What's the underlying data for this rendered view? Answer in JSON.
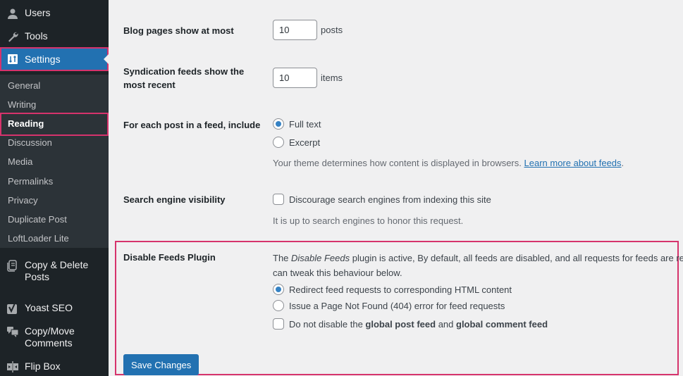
{
  "sidebar": {
    "top_items": [
      {
        "label": "Users",
        "icon": "users-icon"
      },
      {
        "label": "Tools",
        "icon": "wrench-icon"
      },
      {
        "label": "Settings",
        "icon": "settings-icon"
      }
    ],
    "submenu": [
      "General",
      "Writing",
      "Reading",
      "Discussion",
      "Media",
      "Permalinks",
      "Privacy",
      "Duplicate Post",
      "LoftLoader Lite"
    ],
    "current_submenu": "Reading",
    "bottom_items": [
      {
        "label": "Copy & Delete Posts",
        "line1": "Copy & Delete",
        "line2": "Posts",
        "icon": "copy-delete-icon"
      },
      {
        "label": "Yoast SEO",
        "icon": "yoast-icon"
      },
      {
        "label": "Copy/Move Comments",
        "line1": "Copy/Move",
        "line2": "Comments",
        "icon": "comments-icon"
      },
      {
        "label": "Flip Box",
        "icon": "flip-box-icon"
      }
    ]
  },
  "settings": {
    "blog_pages": {
      "label": "Blog pages show at most",
      "value": "10",
      "unit": "posts"
    },
    "syndication": {
      "label_line1": "Syndication feeds show the",
      "label_line2": "most recent",
      "value": "10",
      "unit": "items"
    },
    "feed_include": {
      "label": "For each post in a feed, include",
      "options": [
        "Full text",
        "Excerpt"
      ],
      "selected": "Full text",
      "description": "Your theme determines how content is displayed in browsers.",
      "link_text": "Learn more about feeds",
      "link_suffix": "."
    },
    "search_visibility": {
      "label": "Search engine visibility",
      "checkbox_label": "Discourage search engines from indexing this site",
      "checked": false,
      "description": "It is up to search engines to honor this request."
    },
    "disable_feeds": {
      "label": "Disable Feeds Plugin",
      "desc_prefix": "The ",
      "desc_italic": "Disable Feeds",
      "desc_rest": " plugin is active, By default, all feeds are disabled, and all requests for feeds are re",
      "desc_line2": "can tweak this behaviour below.",
      "options": [
        "Redirect feed requests to corresponding HTML content",
        "Issue a Page Not Found (404) error for feed requests"
      ],
      "selected": "Redirect feed requests to corresponding HTML content",
      "checkbox_prefix": "Do not disable the ",
      "checkbox_bold1": "global post feed",
      "checkbox_mid": " and ",
      "checkbox_bold2": "global comment feed",
      "checkbox_checked": false
    },
    "save_label": "Save Changes"
  },
  "colors": {
    "accent": "#2271b1",
    "highlight": "#d6336c",
    "sidebar_bg": "#1d2327",
    "submenu_bg": "#2c3338"
  }
}
